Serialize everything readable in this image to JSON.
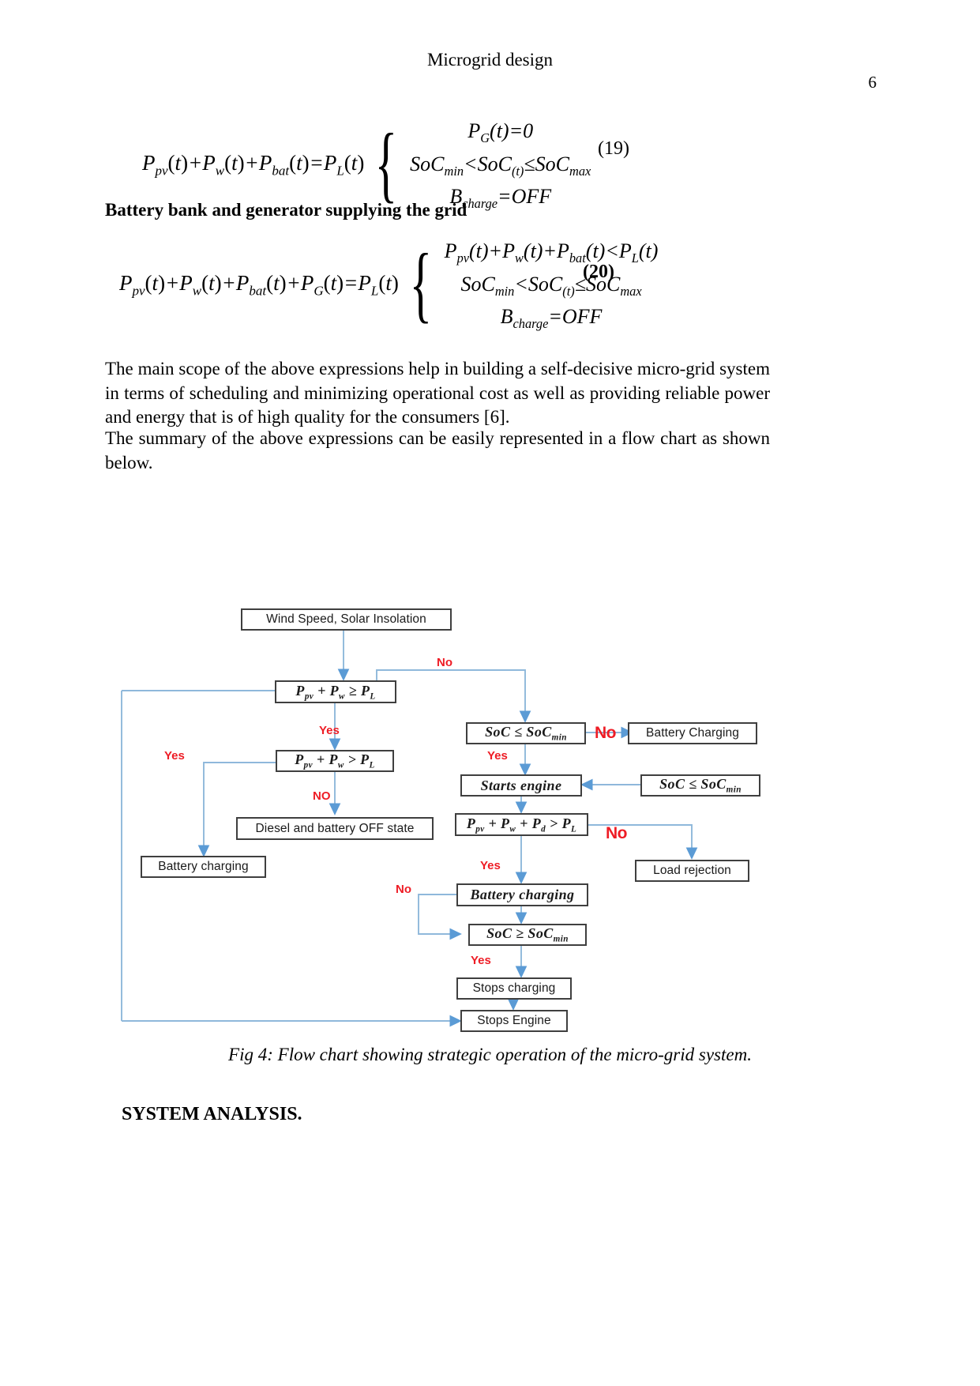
{
  "header": {
    "running_title": "Microgrid design",
    "page_number": "6"
  },
  "equations": [
    {
      "id": "eq19",
      "number": "(19)",
      "lhs": "P_pv(t)+P_w(t)+P_bat(t)=P_L(t)",
      "lines": [
        "P_G(t)=0",
        "SoC_min<SoC_(t)≤SoC_max",
        "B_charge=OFF"
      ]
    },
    {
      "id": "eq20",
      "number": "(20)",
      "lhs": "P_pv(t)+P_w(t)+P_bat(t)+P_G(t)=P_L(t)",
      "lines": [
        "P_pv(t)+P_w(t)+P_bat(t)<P_L(t)",
        "SoC_min<SoC_(t)≤SoC_max",
        "B_charge=OFF"
      ]
    }
  ],
  "headings": {
    "battery_bank": "Battery bank and generator supplying the grid",
    "system_analysis": "SYSTEM ANALYSIS."
  },
  "paragraphs": {
    "p1": "The main scope of the above expressions help in building a self-decisive micro-grid system in terms of scheduling and minimizing operational cost as well as providing reliable power and energy that is of high quality for the consumers [6].",
    "p2": "The summary of the above expressions can be easily represented in a flow chart as shown below."
  },
  "figure": {
    "caption": "Fig 4: Flow chart showing strategic operation of the micro-grid system.",
    "line_color": "#8FB8DB",
    "box_border_color": "#3F3F3F",
    "label_color": "#EE1C25",
    "nodes": [
      {
        "id": "n1",
        "label": "Wind Speed, Solar Insolation",
        "kind": "text"
      },
      {
        "id": "n2",
        "label": "Pₚᵥ + Pᵥᵥ ≥ Pʟ",
        "kind": "math"
      },
      {
        "id": "n3",
        "label": "Pₚᵥ + Pᵥᵥ > Pʟ",
        "kind": "math"
      },
      {
        "id": "n4",
        "label": "Diesel and battery OFF state",
        "kind": "text"
      },
      {
        "id": "n5",
        "label": "Battery charging",
        "kind": "text"
      },
      {
        "id": "n6",
        "label": "SoC ≤ SoCₘᵢₙ",
        "kind": "math"
      },
      {
        "id": "n7",
        "label": "Battery Charging",
        "kind": "text"
      },
      {
        "id": "n8",
        "label": "Starts engine",
        "kind": "math"
      },
      {
        "id": "n9",
        "label": "SoC ≤ SoCₘᵢₙ",
        "kind": "math"
      },
      {
        "id": "n10",
        "label": "Pₚᵥ + Pᵥᵥ + Pᵈ > Pʟ",
        "kind": "math"
      },
      {
        "id": "n11",
        "label": "Load rejection",
        "kind": "text"
      },
      {
        "id": "n12",
        "label": "Battery charging",
        "kind": "math"
      },
      {
        "id": "n13",
        "label": "SoC ≥ SoCₘᵢₙ",
        "kind": "math"
      },
      {
        "id": "n14",
        "label": "Stops charging",
        "kind": "text"
      },
      {
        "id": "n15",
        "label": "Stops Engine",
        "kind": "text"
      }
    ],
    "edge_labels": {
      "no_top": "No",
      "yes_1": "Yes",
      "yes_left": "Yes",
      "no_diesel": "NO",
      "no_batt_charging": "No",
      "yes_soc": "Yes",
      "no_load": "No",
      "yes_pd": "Yes",
      "no_batt2": "No",
      "yes_soc2": "Yes"
    }
  }
}
